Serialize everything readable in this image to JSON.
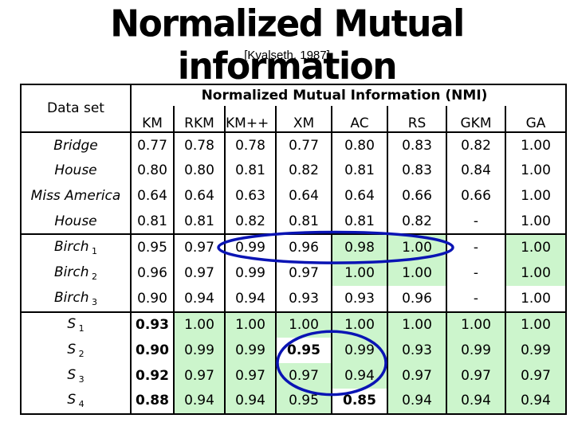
{
  "title": "Normalized Mutual information",
  "citation": "[Kvalseth, 1987]",
  "table": {
    "row_header_label": "Data set",
    "group_header": "Normalized Mutual Information (NMI)",
    "columns": [
      "KM",
      "RKM",
      "KM++",
      "XM",
      "AC",
      "RS",
      "GKM",
      "GA"
    ],
    "groups": [
      {
        "rows": [
          {
            "name": "Bridge",
            "sub": "",
            "values": [
              "0.77",
              "0.78",
              "0.78",
              "0.77",
              "0.80",
              "0.83",
              "0.82",
              "1.00"
            ],
            "green": [],
            "bold": []
          },
          {
            "name": "House",
            "sub": "",
            "values": [
              "0.80",
              "0.80",
              "0.81",
              "0.82",
              "0.81",
              "0.83",
              "0.84",
              "1.00"
            ],
            "green": [],
            "bold": []
          },
          {
            "name": "Miss America",
            "sub": "",
            "values": [
              "0.64",
              "0.64",
              "0.63",
              "0.64",
              "0.64",
              "0.66",
              "0.66",
              "1.00"
            ],
            "green": [],
            "bold": []
          },
          {
            "name": "House",
            "sub": "",
            "values": [
              "0.81",
              "0.81",
              "0.82",
              "0.81",
              "0.81",
              "0.82",
              "-",
              "1.00"
            ],
            "green": [],
            "bold": []
          }
        ]
      },
      {
        "rows": [
          {
            "name": "Birch",
            "sub": "1",
            "values": [
              "0.95",
              "0.97",
              "0.99",
              "0.96",
              "0.98",
              "1.00",
              "-",
              "1.00"
            ],
            "green": [
              4,
              5,
              7
            ],
            "bold": []
          },
          {
            "name": "Birch",
            "sub": "2",
            "values": [
              "0.96",
              "0.97",
              "0.99",
              "0.97",
              "1.00",
              "1.00",
              "-",
              "1.00"
            ],
            "green": [
              4,
              5,
              7
            ],
            "bold": []
          },
          {
            "name": "Birch",
            "sub": "3",
            "values": [
              "0.90",
              "0.94",
              "0.94",
              "0.93",
              "0.93",
              "0.96",
              "-",
              "1.00"
            ],
            "green": [],
            "bold": []
          }
        ]
      },
      {
        "rows": [
          {
            "name": "S",
            "sub": "1",
            "values": [
              "0.93",
              "1.00",
              "1.00",
              "1.00",
              "1.00",
              "1.00",
              "1.00",
              "1.00"
            ],
            "green": [
              1,
              2,
              3,
              4,
              5,
              6,
              7
            ],
            "bold": [
              0
            ]
          },
          {
            "name": "S",
            "sub": "2",
            "values": [
              "0.90",
              "0.99",
              "0.99",
              "0.95",
              "0.99",
              "0.93",
              "0.99",
              "0.99"
            ],
            "green": [
              1,
              2,
              4,
              5,
              6,
              7
            ],
            "bold": [
              0,
              3
            ]
          },
          {
            "name": "S",
            "sub": "3",
            "values": [
              "0.92",
              "0.97",
              "0.97",
              "0.97",
              "0.94",
              "0.97",
              "0.97",
              "0.97"
            ],
            "green": [
              1,
              2,
              3,
              4,
              5,
              6,
              7
            ],
            "bold": [
              0
            ]
          },
          {
            "name": "S",
            "sub": "4",
            "values": [
              "0.88",
              "0.94",
              "0.94",
              "0.95",
              "0.85",
              "0.94",
              "0.94",
              "0.94"
            ],
            "green": [
              1,
              2,
              3,
              5,
              6,
              7
            ],
            "bold": [
              0,
              4
            ]
          }
        ]
      }
    ]
  },
  "annotations": {
    "highlight_color": "#ccf5cc",
    "ellipse_color": "#0a14b4",
    "ellipses": [
      {
        "label": "birch1-circle",
        "row_group": 1,
        "row": 0,
        "from_col": "KM++",
        "to_col": "RS"
      },
      {
        "label": "s2-s3-circle",
        "row_group": 2,
        "rows": [
          1,
          2
        ],
        "from_col": "XM",
        "to_col": "AC"
      }
    ]
  }
}
